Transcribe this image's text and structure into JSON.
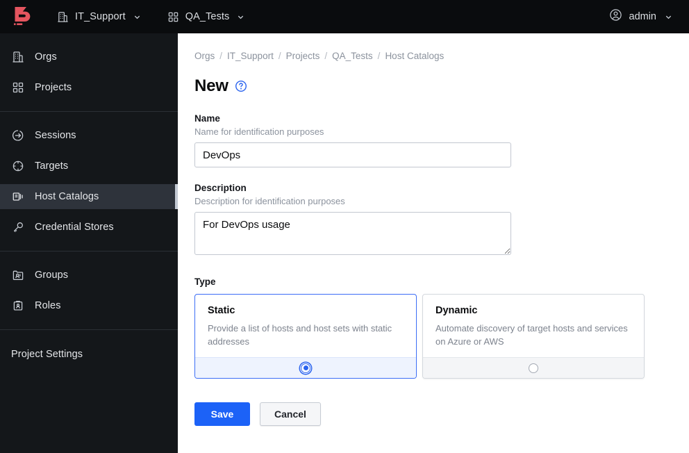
{
  "topbar": {
    "logo_name": "boundary-logo",
    "logo_color": "#e4555f",
    "org_nav": {
      "icon": "building-icon",
      "label": "IT_Support",
      "caret": "chevron-down-icon"
    },
    "project_nav": {
      "icon": "grid-icon",
      "label": "QA_Tests",
      "caret": "chevron-down-icon"
    },
    "user": {
      "icon": "user-circle-icon",
      "label": "admin",
      "caret": "chevron-down-icon"
    }
  },
  "sidebar": {
    "group_one": [
      {
        "label": "Orgs",
        "icon": "building-icon",
        "active": false
      },
      {
        "label": "Projects",
        "icon": "grid-icon",
        "active": false
      }
    ],
    "group_two": [
      {
        "label": "Sessions",
        "icon": "arrow-into-circle-icon",
        "active": false
      },
      {
        "label": "Targets",
        "icon": "target-icon",
        "active": false
      },
      {
        "label": "Host Catalogs",
        "icon": "host-catalog-icon",
        "active": true
      },
      {
        "label": "Credential Stores",
        "icon": "key-icon",
        "active": false
      }
    ],
    "group_three": [
      {
        "label": "Groups",
        "icon": "groups-icon",
        "active": false
      },
      {
        "label": "Roles",
        "icon": "roles-badge-icon",
        "active": false
      }
    ],
    "group_four": [
      {
        "label": "Project Settings",
        "icon": "none",
        "active": false
      }
    ]
  },
  "breadcrumb": {
    "items": [
      "Orgs",
      "IT_Support",
      "Projects",
      "QA_Tests",
      "Host Catalogs"
    ],
    "separator": "/"
  },
  "page": {
    "title": "New",
    "help_icon": "question-circle-icon",
    "help_icon_color": "#2a63ee"
  },
  "form": {
    "name": {
      "label": "Name",
      "help": "Name for identification purposes",
      "value": "DevOps",
      "placeholder": ""
    },
    "description": {
      "label": "Description",
      "help": "Description for identification purposes",
      "value": "For DevOps usage",
      "placeholder": ""
    },
    "type": {
      "label": "Type",
      "options": [
        {
          "title": "Static",
          "description": "Provide a list of hosts and host sets with static addresses",
          "selected": true
        },
        {
          "title": "Dynamic",
          "description": "Automate discovery of target hosts and services on Azure or AWS",
          "selected": false
        }
      ]
    },
    "actions": {
      "save_label": "Save",
      "cancel_label": "Cancel",
      "save_color": "#1c62f7"
    }
  }
}
